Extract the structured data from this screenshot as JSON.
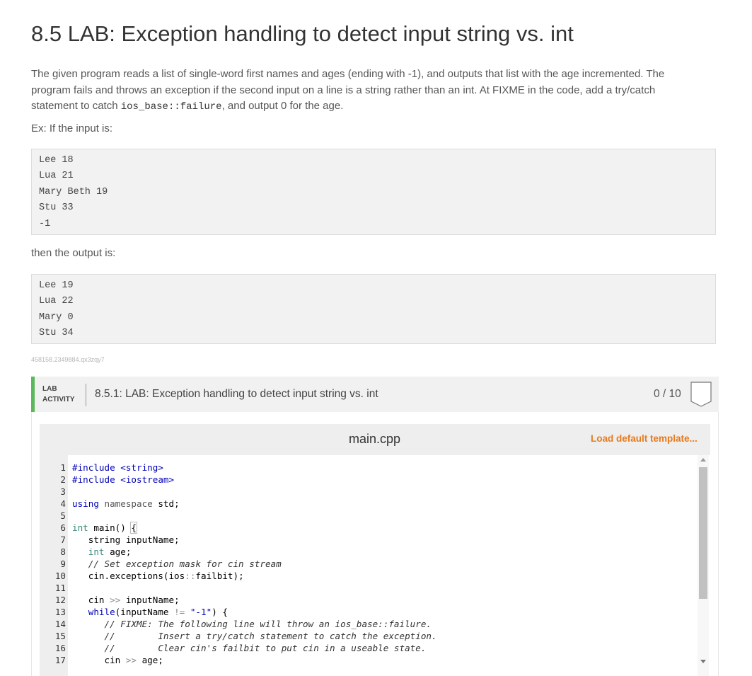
{
  "title": "8.5 LAB: Exception handling to detect input string vs. int",
  "description": {
    "part1": "The given program reads a list of single-word first names and ages (ending with -1), and outputs that list with the age incremented. The program fails and throws an exception if the second input on a line is a string rather than an int. At FIXME in the code, add a try/catch statement to catch ",
    "code": "ios_base::failure",
    "part2": ", and output 0 for the age."
  },
  "example_label": "Ex: If the input is:",
  "input_lines": [
    "Lee 18",
    "Lua 21",
    "Mary Beth 19",
    "Stu 33",
    "-1"
  ],
  "then_label": "then the output is:",
  "output_lines": [
    "Lee 19",
    "Lua 22",
    "Mary 0",
    "Stu 34"
  ],
  "activity_id": "458158.2349884.qx3zqy7",
  "lab": {
    "tag_line1": "LAB",
    "tag_line2": "ACTIVITY",
    "name": "8.5.1: LAB: Exception handling to detect input string vs. int",
    "score": "0 / 10"
  },
  "editor": {
    "file_name": "main.cpp",
    "load_template_label": "Load default template...",
    "lines": [
      {
        "n": "1",
        "text": "#include <string>"
      },
      {
        "n": "2",
        "text": "#include <iostream>"
      },
      {
        "n": "3",
        "text": ""
      },
      {
        "n": "4",
        "text": "using namespace std;"
      },
      {
        "n": "5",
        "text": ""
      },
      {
        "n": "6",
        "text": "int main() {"
      },
      {
        "n": "7",
        "text": "   string inputName;"
      },
      {
        "n": "8",
        "text": "   int age;"
      },
      {
        "n": "9",
        "text": "   // Set exception mask for cin stream"
      },
      {
        "n": "10",
        "text": "   cin.exceptions(ios::failbit);"
      },
      {
        "n": "11",
        "text": ""
      },
      {
        "n": "12",
        "text": "   cin >> inputName;"
      },
      {
        "n": "13",
        "text": "   while(inputName != \"-1\") {"
      },
      {
        "n": "14",
        "text": "      // FIXME: The following line will throw an ios_base::failure."
      },
      {
        "n": "15",
        "text": "      //        Insert a try/catch statement to catch the exception."
      },
      {
        "n": "16",
        "text": "      //        Clear cin's failbit to put cin in a useable state."
      },
      {
        "n": "17",
        "text": "      cin >> age;"
      }
    ]
  },
  "colors": {
    "accent_green": "#5cb85c",
    "load_orange": "#e8791d"
  }
}
